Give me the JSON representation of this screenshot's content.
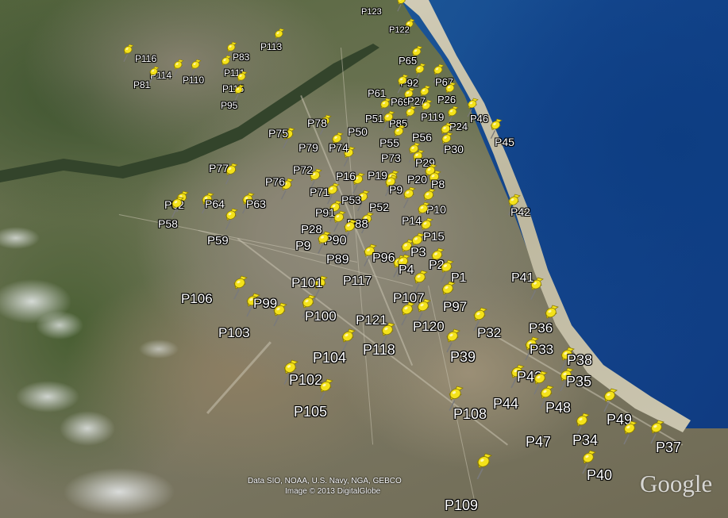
{
  "map": {
    "attribution_line1": "Data SIO, NOAA, U.S. Navy, NGA, GEBCO",
    "attribution_line2": "Image © 2013 DigitalGlobe",
    "logo": "Google",
    "pin_icon": "yellow-pushpin-icon",
    "pin_color": "#f4e21a",
    "label_color": "#ffffff"
  },
  "placemarks": [
    "P123",
    "P122",
    "P116",
    "P83",
    "P113",
    "P111",
    "P114",
    "P110",
    "P81",
    "P115",
    "P95",
    "P65",
    "P92",
    "P67",
    "P61",
    "P69",
    "P27",
    "P26",
    "P51",
    "P85",
    "P119",
    "P46",
    "P24",
    "P50",
    "P55",
    "P56",
    "P45",
    "P30",
    "P75",
    "P78",
    "P79",
    "P74",
    "P73",
    "P29",
    "P77",
    "P72",
    "P16",
    "P19",
    "P20",
    "P8",
    "P76",
    "P71",
    "P9",
    "P62",
    "P64",
    "P63",
    "P53",
    "P52",
    "P42",
    "P10",
    "P58",
    "P91",
    "P14",
    "P88",
    "P28",
    "P15",
    "P59",
    "P90",
    "P9",
    "P89",
    "P96",
    "P3",
    "P117",
    "P2",
    "P4",
    "P1",
    "P41",
    "P101",
    "P106",
    "P99",
    "P107",
    "P97",
    "P100",
    "P103",
    "P121",
    "P120",
    "P32",
    "P36",
    "P33",
    "P104",
    "P118",
    "P39",
    "P38",
    "P43",
    "P35",
    "P102",
    "P44",
    "P48",
    "P105",
    "P108",
    "P49",
    "P47",
    "P34",
    "P37",
    "P40",
    "P109"
  ]
}
